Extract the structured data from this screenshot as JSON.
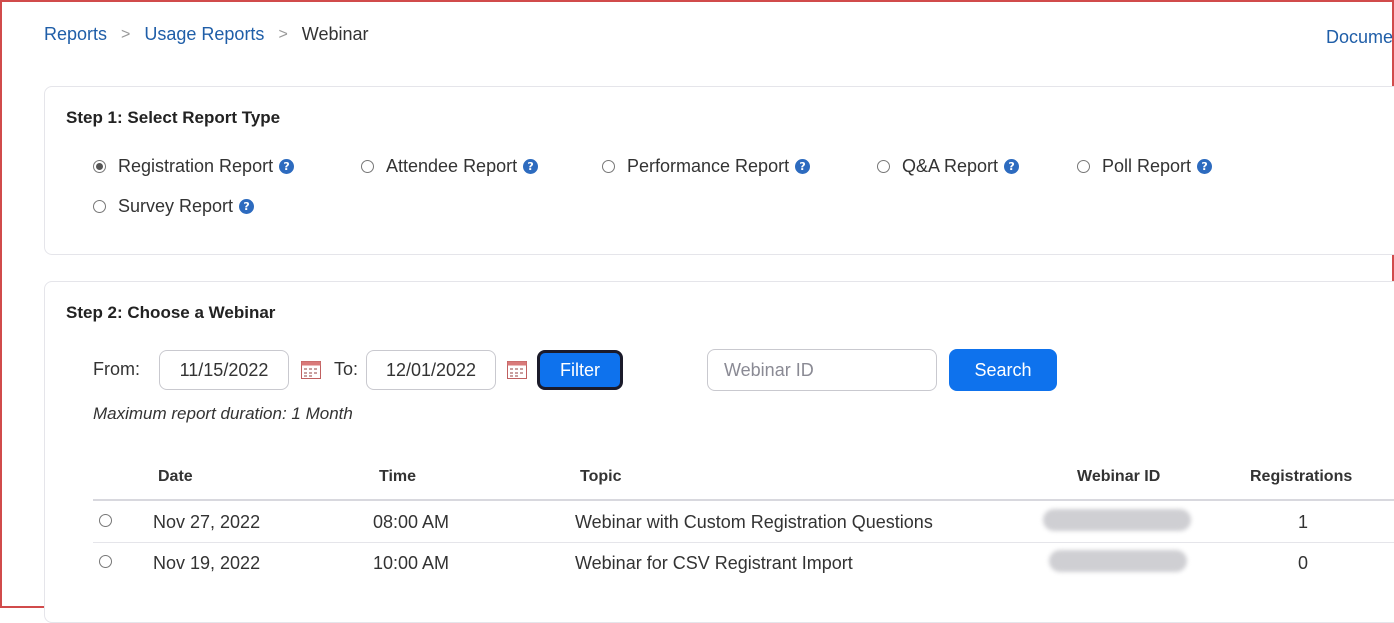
{
  "breadcrumb": {
    "items": [
      "Reports",
      "Usage Reports"
    ],
    "current": "Webinar"
  },
  "top_right_link": "Docume",
  "step1": {
    "title": "Step 1: Select Report Type",
    "options": [
      {
        "label": "Registration Report",
        "checked": true
      },
      {
        "label": "Attendee Report",
        "checked": false
      },
      {
        "label": "Performance Report",
        "checked": false
      },
      {
        "label": "Q&A Report",
        "checked": false
      },
      {
        "label": "Poll Report",
        "checked": false
      },
      {
        "label": "Survey Report",
        "checked": false
      }
    ]
  },
  "step2": {
    "title": "Step 2: Choose a Webinar",
    "from_label": "From:",
    "from_value": "11/15/2022",
    "to_label": "To:",
    "to_value": "12/01/2022",
    "filter_label": "Filter",
    "webinar_id_placeholder": "Webinar ID",
    "search_label": "Search",
    "note": "Maximum report duration: 1 Month"
  },
  "table": {
    "headers": [
      "Date",
      "Time",
      "Topic",
      "Webinar ID",
      "Registrations"
    ],
    "rows": [
      {
        "date": "Nov 27, 2022",
        "time": "08:00 AM",
        "topic": "Webinar with Custom Registration Questions",
        "registrations": "1"
      },
      {
        "date": "Nov 19, 2022",
        "time": "10:00 AM",
        "topic": "Webinar for CSV Registrant Import",
        "registrations": "0"
      }
    ]
  },
  "colors": {
    "accent": "#0e72ed",
    "link": "#1f5ea8",
    "help_icon": "#2d6bbf",
    "frame": "#d14b4b"
  }
}
